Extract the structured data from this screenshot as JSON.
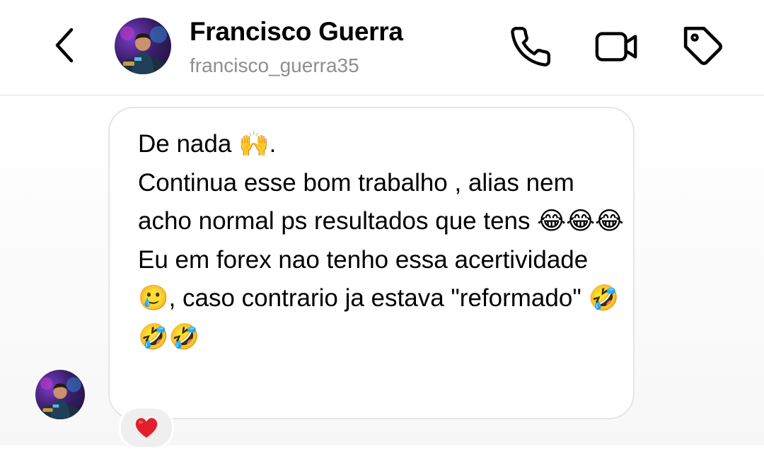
{
  "header": {
    "name": "Francisco Guerra",
    "username": "francisco_guerra35",
    "icons": {
      "back": "chevron-left-icon",
      "call": "phone-icon",
      "video": "video-camera-icon",
      "tag": "tag-icon"
    }
  },
  "message": {
    "text": "De nada 🙌.\nContinua esse bom trabalho , alias nem acho normal ps resultados que tens 😂😂😂\nEu em forex nao tenho essa acertividade 🥲, caso contrario ja estava \"reformado\" 🤣🤣🤣",
    "reaction": "❤️"
  },
  "colors": {
    "username": "#8e8e8e",
    "divider": "#e3e3e3",
    "bubble_border": "#e6e6e6",
    "reaction_bg": "#efefef"
  }
}
